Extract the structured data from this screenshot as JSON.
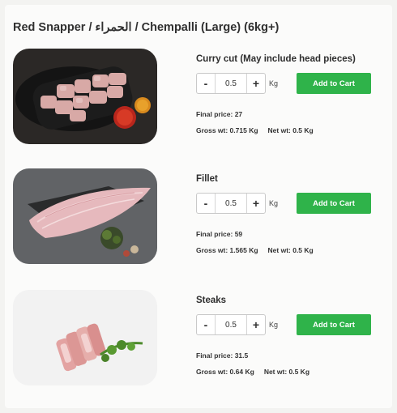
{
  "page_title": "Red Snapper / الحمراء / Chempalli (Large) (6kg+)",
  "colors": {
    "accent": "#2fb34a",
    "background": "#f3f3f1"
  },
  "products": [
    {
      "name": "Curry cut (May include head pieces)",
      "quantity": "0.5",
      "unit": "Kg",
      "minus_label": "-",
      "plus_label": "+",
      "add_label": "Add to Cart",
      "final_price": "Final price: 27",
      "gross_wt": "Gross wt: 0.715 Kg",
      "net_wt": "Net wt: 0.5 Kg"
    },
    {
      "name": "Fillet",
      "quantity": "0.5",
      "unit": "Kg",
      "minus_label": "-",
      "plus_label": "+",
      "add_label": "Add to Cart",
      "final_price": "Final price: 59",
      "gross_wt": "Gross wt: 1.565 Kg",
      "net_wt": "Net wt: 0.5 Kg"
    },
    {
      "name": "Steaks",
      "quantity": "0.5",
      "unit": "Kg",
      "minus_label": "-",
      "plus_label": "+",
      "add_label": "Add to Cart",
      "final_price": "Final price: 31.5",
      "gross_wt": "Gross wt: 0.64 Kg",
      "net_wt": "Net wt: 0.5 Kg"
    }
  ]
}
